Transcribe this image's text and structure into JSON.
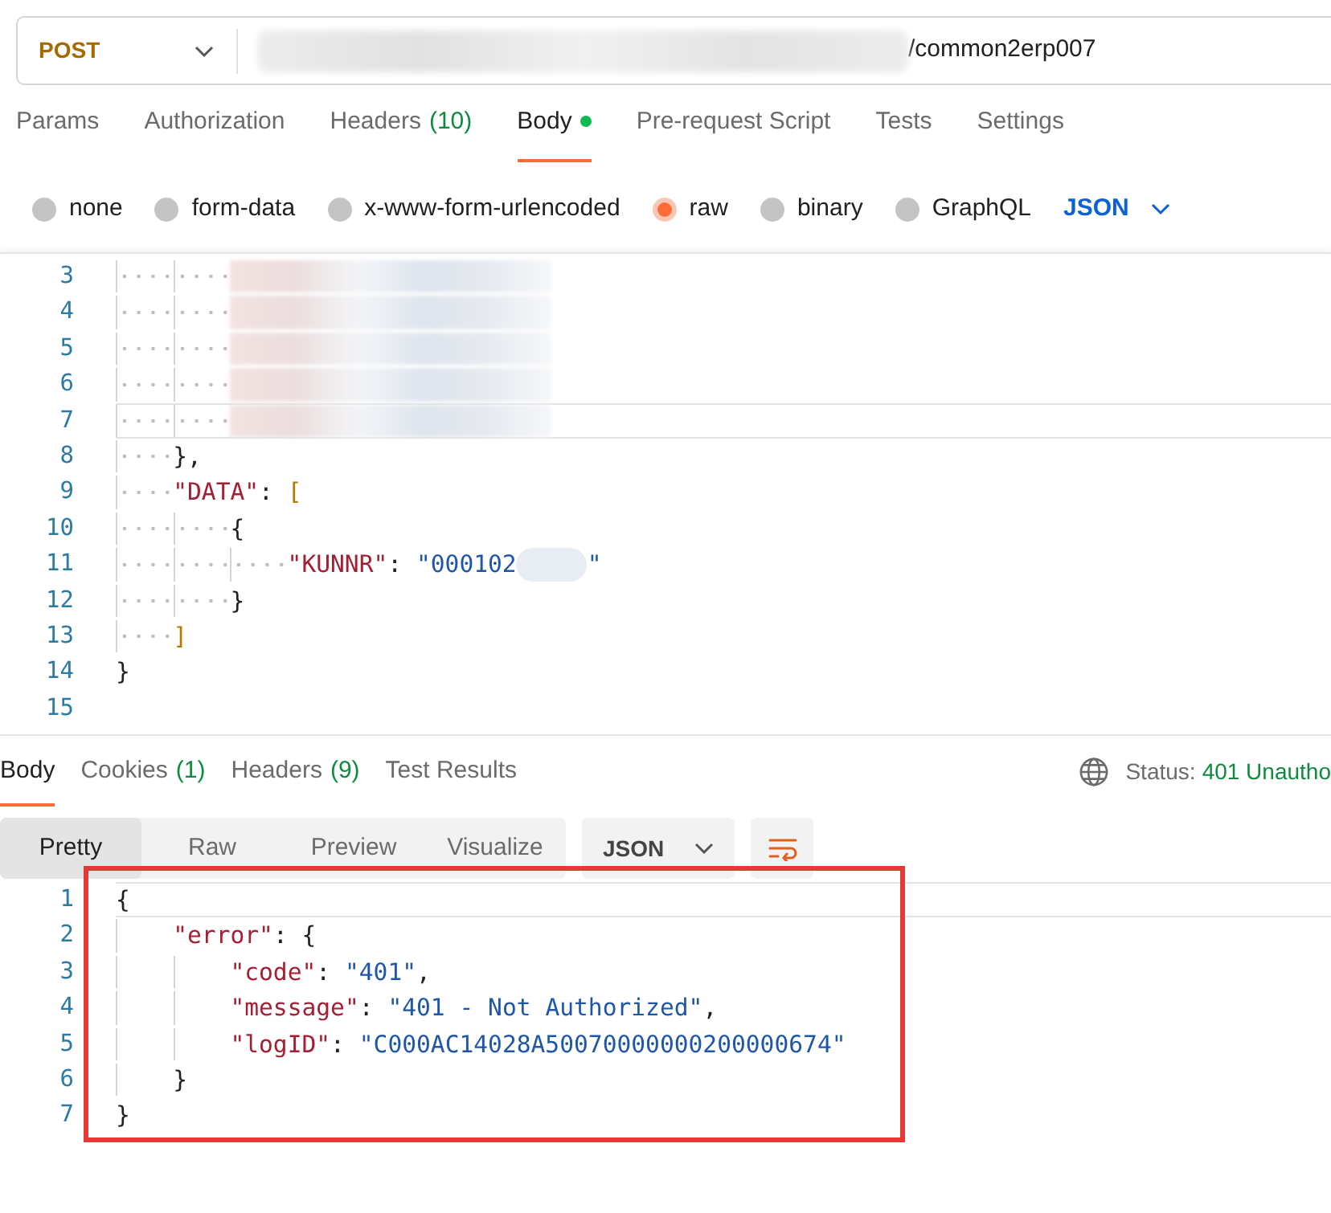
{
  "request": {
    "method": "POST",
    "url": {
      "redacted": true,
      "text": "/common2erp007"
    }
  },
  "request_tabs": [
    {
      "label": "Params",
      "selected": false
    },
    {
      "label": "Authorization",
      "selected": false
    },
    {
      "label": "Headers",
      "count": "(10)",
      "selected": false
    },
    {
      "label": "Body",
      "selected": true,
      "has_content": true
    },
    {
      "label": "Pre-request Script",
      "selected": false
    },
    {
      "label": "Tests",
      "selected": false
    },
    {
      "label": "Settings",
      "selected": false
    }
  ],
  "body_types": [
    {
      "label": "none",
      "selected": false
    },
    {
      "label": "form-data",
      "selected": false
    },
    {
      "label": "x-www-form-urlencoded",
      "selected": false
    },
    {
      "label": "raw",
      "selected": true
    },
    {
      "label": "binary",
      "selected": false
    },
    {
      "label": "GraphQL",
      "selected": false
    }
  ],
  "body_language": "JSON",
  "request_body": {
    "show_whitespace": true,
    "lines": [
      {
        "children": [
          {
            "children": [
              {
                "number": "3",
                "active": false,
                "tokens": [
                  {
                    "kind": "redacted"
                  }
                ]
              },
              {
                "number": "4",
                "active": false,
                "tokens": [
                  {
                    "kind": "redacted"
                  }
                ]
              },
              {
                "number": "5",
                "active": false,
                "tokens": [
                  {
                    "kind": "redacted"
                  }
                ]
              },
              {
                "number": "6",
                "active": false,
                "tokens": [
                  {
                    "kind": "redacted"
                  }
                ]
              },
              {
                "number": "7",
                "active": true,
                "tokens": [
                  {
                    "kind": "redacted"
                  }
                ]
              }
            ]
          },
          {
            "number": "8",
            "active": false,
            "tokens": [
              {
                "kind": "punct",
                "text": "},"
              }
            ]
          },
          {
            "number": "9",
            "active": false,
            "tokens": [
              {
                "kind": "key",
                "text": "\"DATA\""
              },
              {
                "kind": "punct",
                "text": ": "
              },
              {
                "kind": "bracket",
                "text": "["
              }
            ],
            "children": [
              {
                "number": "10",
                "active": false,
                "tokens": [
                  {
                    "kind": "punct",
                    "text": "{"
                  }
                ],
                "children": [
                  {
                    "number": "11",
                    "active": false,
                    "tokens": [
                      {
                        "kind": "key",
                        "text": "\"KUNNR\""
                      },
                      {
                        "kind": "punct",
                        "text": ": "
                      },
                      {
                        "kind": "string",
                        "text": "\"000102"
                      },
                      {
                        "kind": "redacted_small"
                      },
                      {
                        "kind": "string",
                        "text": "\""
                      }
                    ]
                  }
                ]
              },
              {
                "number": "12",
                "active": false,
                "tokens": [
                  {
                    "kind": "punct",
                    "text": "}"
                  }
                ]
              }
            ]
          },
          {
            "number": "13",
            "active": false,
            "tokens": [
              {
                "kind": "bracket",
                "text": "]"
              }
            ]
          }
        ]
      },
      {
        "number": "14",
        "active": false,
        "tokens": [
          {
            "kind": "punct",
            "text": "}"
          }
        ]
      },
      {
        "number": "15",
        "active": false
      }
    ]
  },
  "response_tabs": [
    {
      "label": "Body",
      "selected": true
    },
    {
      "label": "Cookies",
      "count": "(1)",
      "selected": false
    },
    {
      "label": "Headers",
      "count": "(9)",
      "selected": false
    },
    {
      "label": "Test Results",
      "selected": false
    }
  ],
  "status": {
    "label": "Status:",
    "value": "401 Unautho"
  },
  "view_modes": [
    {
      "label": "Pretty",
      "selected": true
    },
    {
      "label": "Raw",
      "selected": false
    },
    {
      "label": "Preview",
      "selected": false
    },
    {
      "label": "Visualize",
      "selected": false
    }
  ],
  "response_language": "JSON",
  "response_body": {
    "show_whitespace": false,
    "highlighted": true,
    "lines": [
      {
        "number": "1",
        "active": true,
        "tokens": [
          {
            "kind": "punct",
            "text": "{"
          }
        ],
        "children": [
          {
            "number": "2",
            "active": false,
            "tokens": [
              {
                "kind": "key",
                "text": "\"error\""
              },
              {
                "kind": "punct",
                "text": ": {"
              }
            ],
            "children": [
              {
                "number": "3",
                "active": false,
                "tokens": [
                  {
                    "kind": "key",
                    "text": "\"code\""
                  },
                  {
                    "kind": "punct",
                    "text": ": "
                  },
                  {
                    "kind": "string",
                    "text": "\"401\""
                  },
                  {
                    "kind": "punct",
                    "text": ","
                  }
                ]
              },
              {
                "number": "4",
                "active": false,
                "tokens": [
                  {
                    "kind": "key",
                    "text": "\"message\""
                  },
                  {
                    "kind": "punct",
                    "text": ": "
                  },
                  {
                    "kind": "string",
                    "text": "\"401 - Not Authorized\""
                  },
                  {
                    "kind": "punct",
                    "text": ","
                  }
                ]
              },
              {
                "number": "5",
                "active": false,
                "tokens": [
                  {
                    "kind": "key",
                    "text": "\"logID\""
                  },
                  {
                    "kind": "punct",
                    "text": ": "
                  },
                  {
                    "kind": "string",
                    "text": "\"C000AC14028A50070000000200000674\""
                  }
                ]
              }
            ]
          },
          {
            "number": "6",
            "active": false,
            "tokens": [
              {
                "kind": "punct",
                "text": "}"
              }
            ]
          }
        ]
      },
      {
        "number": "7",
        "active": false,
        "tokens": [
          {
            "kind": "punct",
            "text": "}"
          }
        ]
      }
    ]
  }
}
